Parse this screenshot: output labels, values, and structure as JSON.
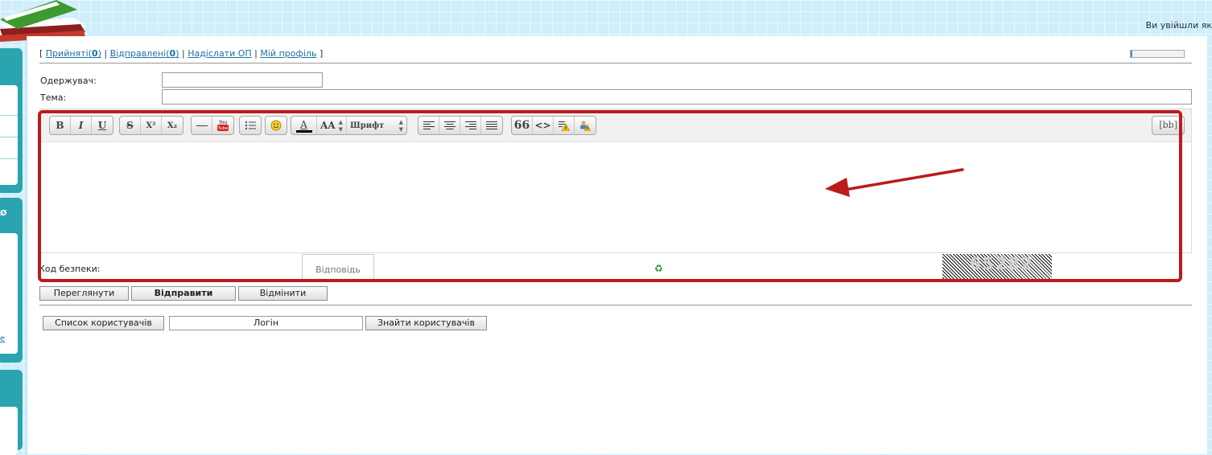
{
  "header": {
    "welcome_text": "Ви увійшли як"
  },
  "topnav": {
    "received_label": "Прийняті",
    "received_count": "0",
    "sent_label": "Відправлені",
    "sent_count": "0",
    "send_label": "Надіслати ОП",
    "profile_label": "Мій профіль"
  },
  "form": {
    "recipient_label": "Одержувач:",
    "recipient_value": "",
    "subject_label": "Тема:",
    "subject_value": ""
  },
  "editor": {
    "toolbar": {
      "bold": "B",
      "italic": "I",
      "underline": "U",
      "strike": "S",
      "superscript": "X²",
      "subscript": "X₂",
      "youtube": "You Tube",
      "font_size": "AA",
      "font_name": "Шрифт",
      "quote": "66",
      "code": "<>",
      "bb": "[bb]"
    },
    "icons": [
      "bold-icon",
      "italic-icon",
      "underline-icon",
      "strikethrough-icon",
      "superscript-icon",
      "subscript-icon",
      "hr-icon",
      "youtube-icon",
      "list-icon",
      "smile-icon",
      "font-color-icon",
      "font-size-icon",
      "font-select-icon",
      "align-left-icon",
      "align-center-icon",
      "align-right-icon",
      "align-justify-icon",
      "quote-icon",
      "code-icon",
      "spoiler-icon",
      "hide-icon"
    ],
    "accent_color": "#bb1b1b"
  },
  "security": {
    "label": "Код безпеки:",
    "answer_placeholder": "Відповідь",
    "captcha_code": "65282"
  },
  "buttons": {
    "preview": "Переглянути",
    "send": "Відправити",
    "cancel": "Відмінити"
  },
  "users": {
    "list_button": "Список користувачів",
    "login_placeholder": "Логін",
    "find_button": "Знайти користувачів"
  }
}
